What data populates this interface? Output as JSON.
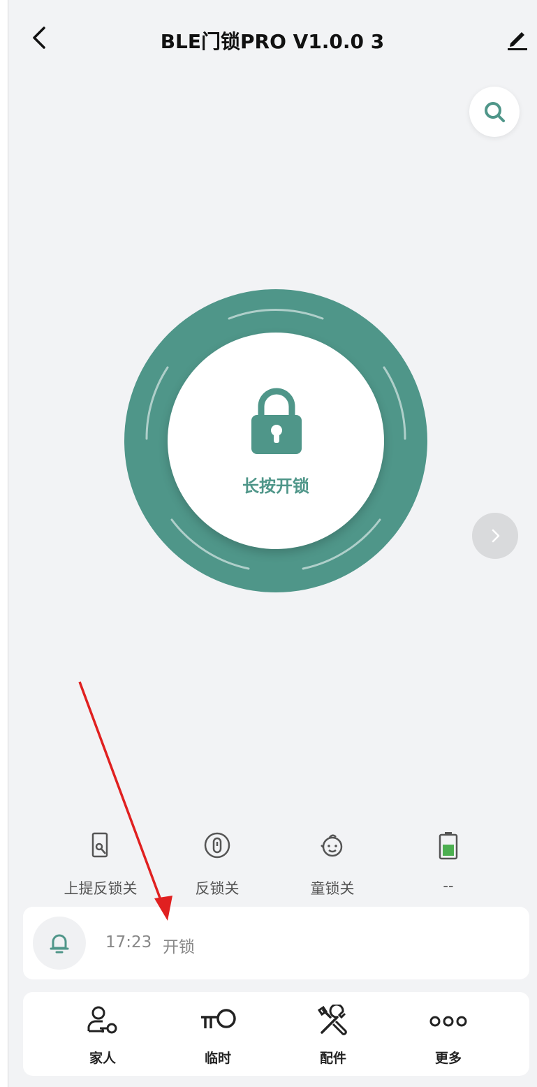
{
  "header": {
    "title": "BLE门锁PRO V1.0.0 3",
    "back_icon": "chevron-left-icon",
    "edit_icon": "pencil-icon"
  },
  "search": {
    "icon": "search-icon"
  },
  "lock": {
    "action_label": "长按开锁",
    "icon": "padlock-icon",
    "color": "#4f9689"
  },
  "next": {
    "icon": "chevron-right-icon"
  },
  "status": [
    {
      "label": "上提反锁关",
      "icon": "door-handle-icon"
    },
    {
      "label": "反锁关",
      "icon": "deadbolt-icon"
    },
    {
      "label": "童锁关",
      "icon": "child-face-icon"
    },
    {
      "label": "--",
      "icon": "battery-icon"
    }
  ],
  "notification": {
    "time": "17:23",
    "text": "开锁",
    "icon": "bell-icon"
  },
  "nav": [
    {
      "label": "家人",
      "icon": "family-key-icon"
    },
    {
      "label": "临时",
      "icon": "temporary-key-icon"
    },
    {
      "label": "配件",
      "icon": "tools-icon"
    },
    {
      "label": "更多",
      "icon": "more-dots-icon"
    }
  ],
  "colors": {
    "accent": "#4f9689",
    "background": "#f2f3f5",
    "annotation": "#e02020"
  }
}
